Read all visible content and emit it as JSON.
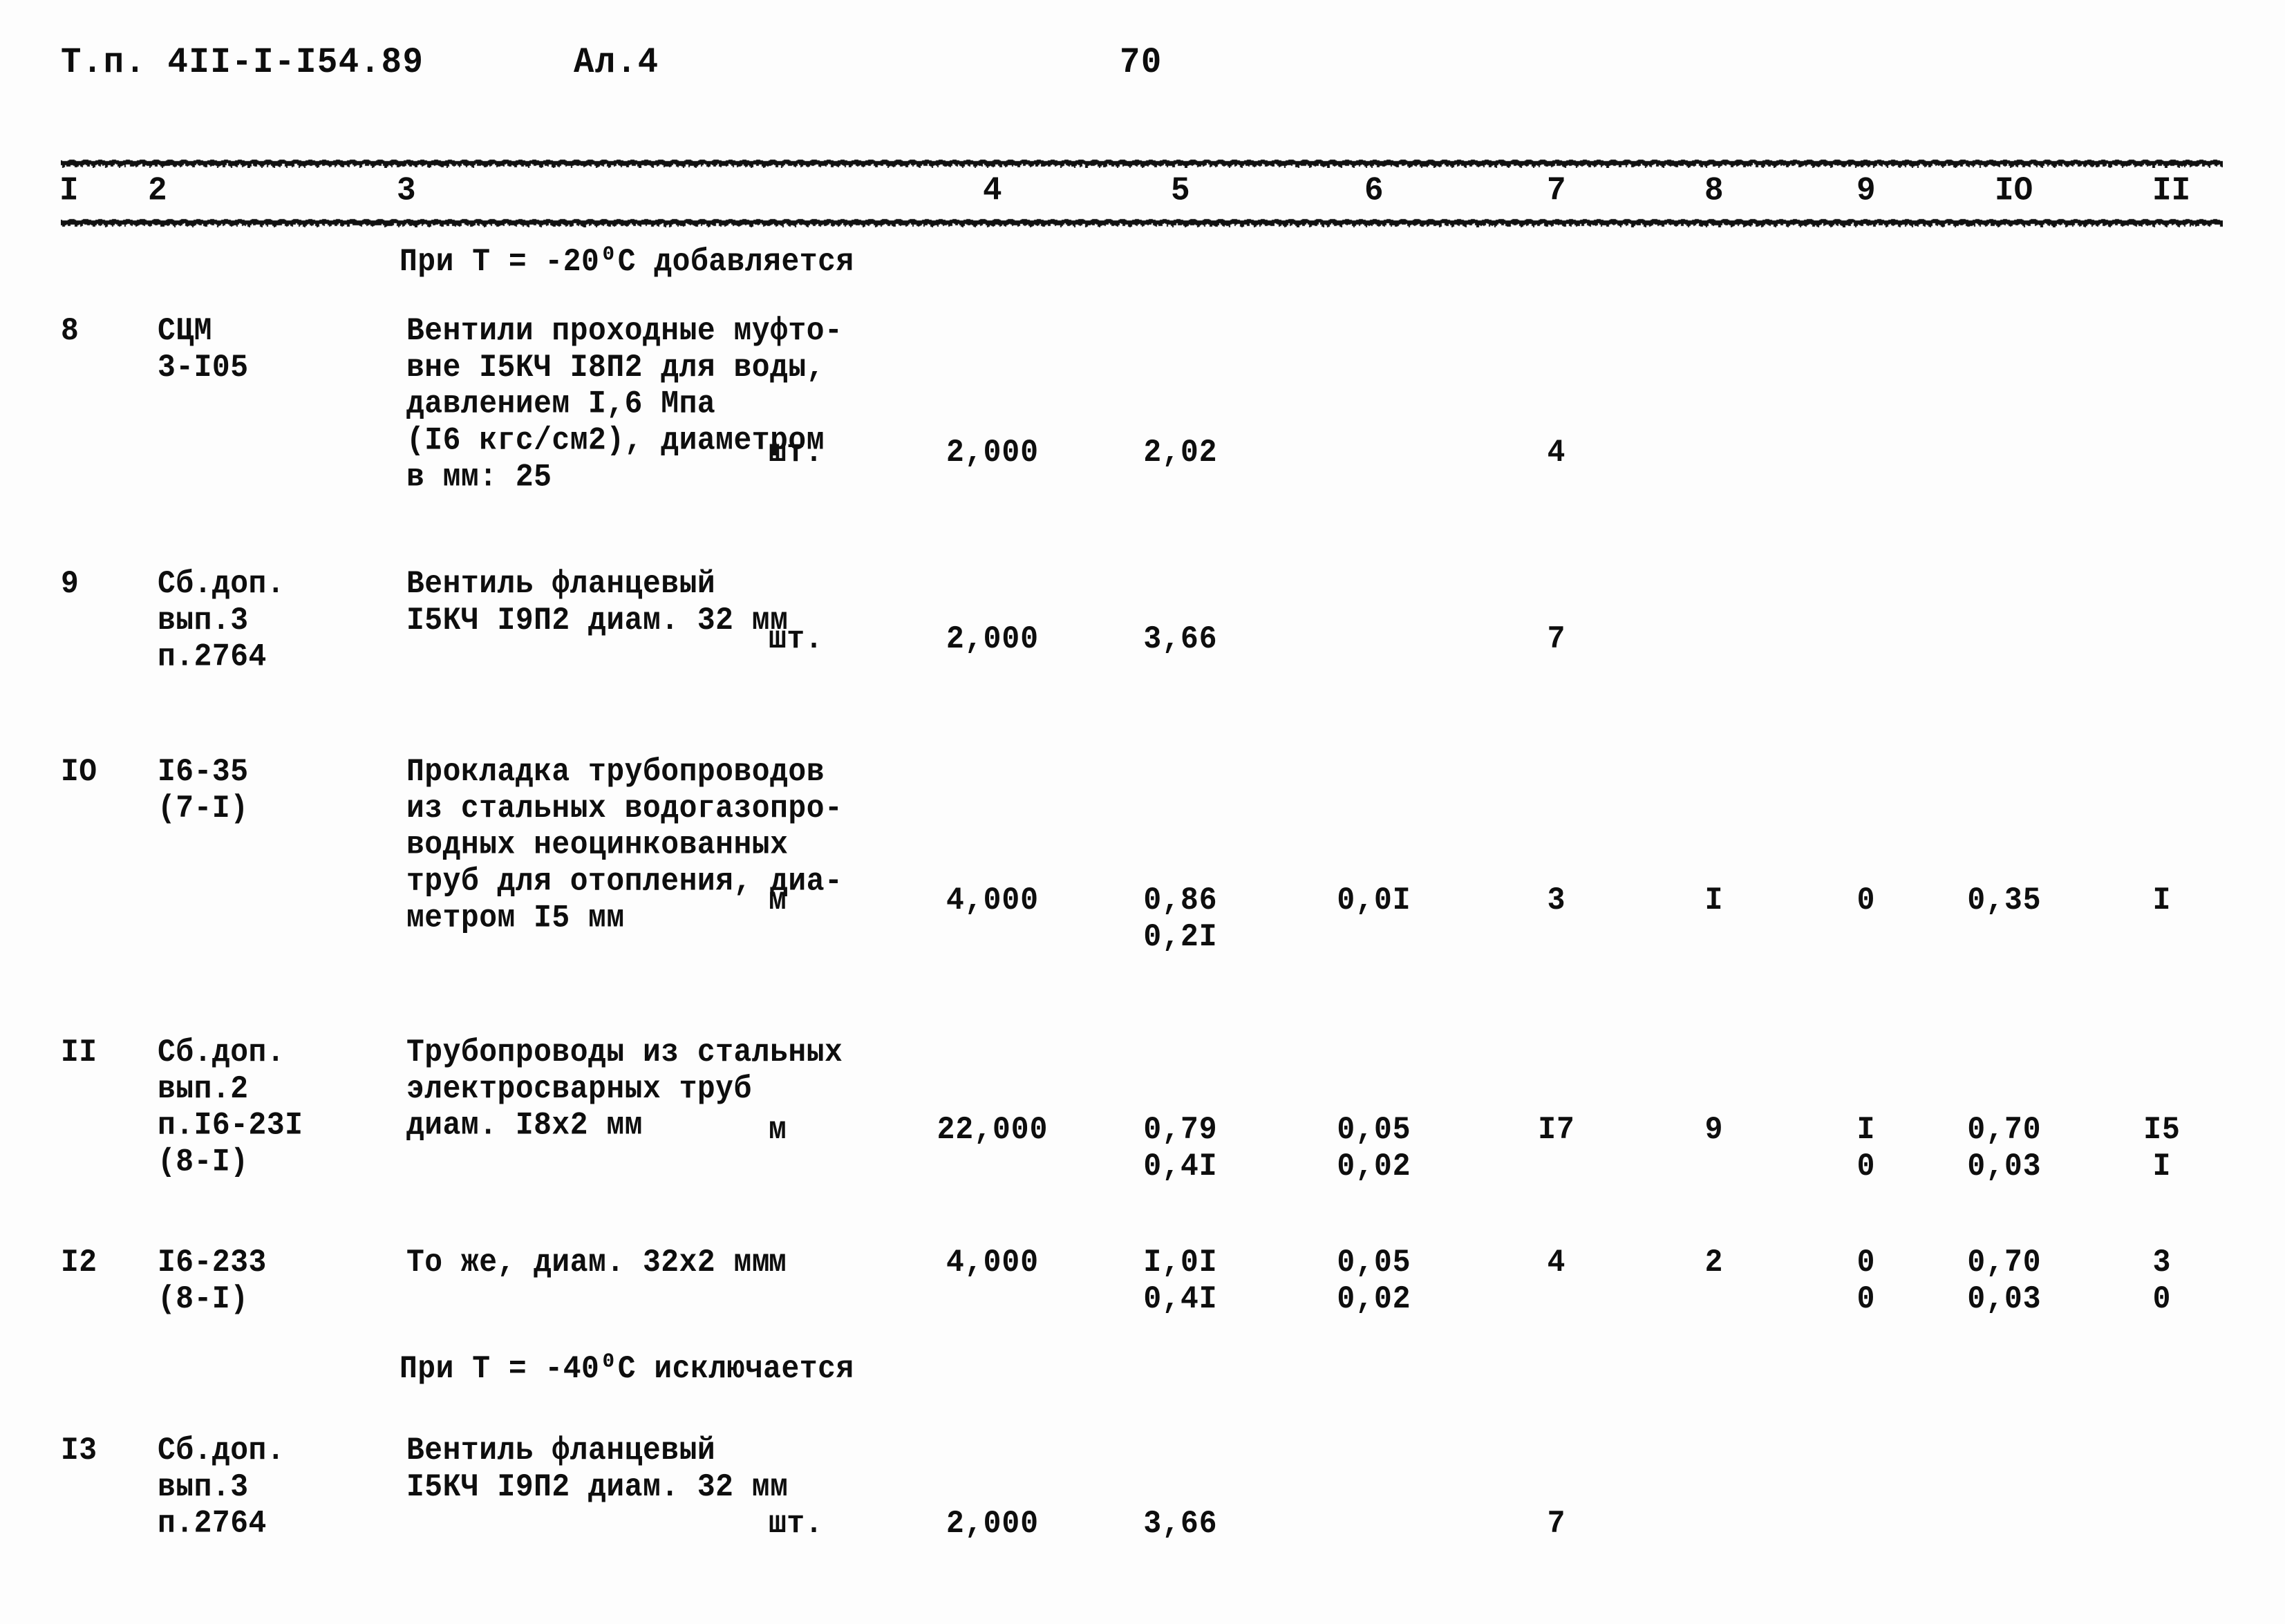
{
  "document": {
    "header": {
      "type_code": "Т.п. 4II-I-I54.89",
      "album": "Ал.4",
      "page_number": "70"
    },
    "column_headers": [
      "I",
      "2",
      "3",
      "4",
      "5",
      "6",
      "7",
      "8",
      "9",
      "IO",
      "II"
    ],
    "notes": {
      "note_minus20": "При Т = -20⁰С добавляется",
      "note_minus40": "При Т = -40⁰С исключается"
    },
    "rows": [
      {
        "index": "8",
        "code": "СЦМ\n3-I05",
        "description": "Вентили проходные муфто-\nвне I5КЧ I8П2 для воды,\nдавлением I,6 Мпа\n(I6 кгс/см2), диаметром\nв мм: 25",
        "unit": "шт.",
        "c4": "2,000",
        "c5": "2,02",
        "c6": "",
        "c7": "4",
        "c8": "",
        "c9": "",
        "c10": "",
        "c11": ""
      },
      {
        "index": "9",
        "code": "Сб.доп.\nвып.3\nп.2764",
        "description": "Вентиль фланцевый\nI5КЧ I9П2 диам. 32 мм",
        "unit": "шт.",
        "c4": "2,000",
        "c5": "3,66",
        "c6": "",
        "c7": "7",
        "c8": "",
        "c9": "",
        "c10": "",
        "c11": ""
      },
      {
        "index": "IO",
        "code": "I6-35\n(7-I)",
        "description": "Прокладка трубопроводов\nиз стальных водогазопро-\nводных неоцинкованных\nтруб для отопления, диа-\nметром I5 мм",
        "unit": "м",
        "c4": "4,000",
        "c5": "0,86\n0,2I",
        "c6": "0,0I",
        "c7": "3",
        "c8": "I",
        "c9": "0",
        "c10": "0,35",
        "c11": "I"
      },
      {
        "index": "II",
        "code": "Сб.доп.\nвып.2\nп.I6-23I\n(8-I)",
        "description": "Трубопроводы из стальных\nэлектросварных труб\nдиам. I8х2 мм",
        "unit": "м",
        "c4": "22,000",
        "c5": "0,79\n0,4I",
        "c6": "0,05\n0,02",
        "c7": "I7",
        "c8": "9",
        "c9": "I\n0",
        "c10": "0,70\n0,03",
        "c11": "I5\nI"
      },
      {
        "index": "I2",
        "code": "I6-233\n(8-I)",
        "description": "То же, диам. 32х2 мм",
        "unit": "м",
        "c4": "4,000",
        "c5": "I,0I\n0,4I",
        "c6": "0,05\n0,02",
        "c7": "4",
        "c8": "2",
        "c9": "0\n0",
        "c10": "0,70\n0,03",
        "c11": "3\n0"
      },
      {
        "index": "I3",
        "code": "Сб.доп.\nвып.3\nп.2764",
        "description": "Вентиль фланцевый\nI5КЧ I9П2 диам. 32 мм",
        "unit": "шт.",
        "c4": "2,000",
        "c5": "3,66",
        "c6": "",
        "c7": "7",
        "c8": "",
        "c9": "",
        "c10": "",
        "c11": ""
      }
    ]
  }
}
